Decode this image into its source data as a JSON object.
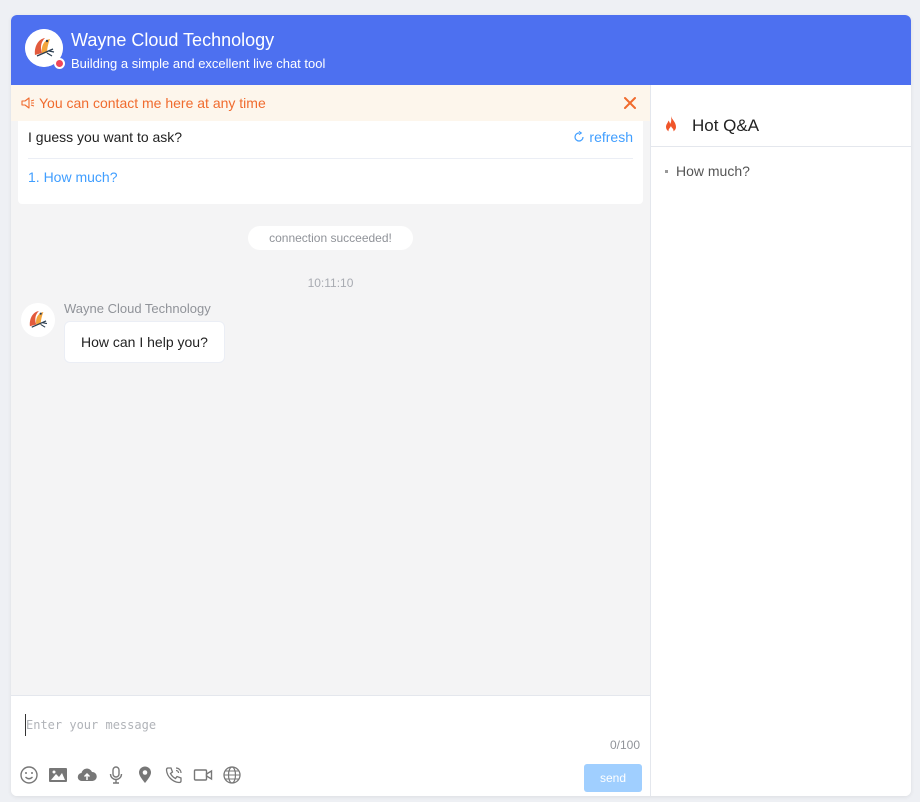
{
  "header": {
    "title": "Wayne Cloud Technology",
    "subtitle": "Building a simple and excellent live chat tool",
    "status_color": "#f0475a"
  },
  "notice": {
    "text": "You can contact me here at any time",
    "icon": "speaker-icon",
    "color": "#f06b2e"
  },
  "guess": {
    "title": "I guess you want to ask?",
    "refresh_label": "refresh",
    "items": [
      "1. How much?"
    ]
  },
  "chat": {
    "system_message": "connection succeeded!",
    "timestamp": "10:11:10",
    "messages": [
      {
        "sender": "Wayne Cloud Technology",
        "text": "How can I help you?"
      }
    ]
  },
  "input": {
    "placeholder": "Enter your message",
    "value": "",
    "counter": "0/100",
    "send_label": "send",
    "tools": [
      "emoji-icon",
      "image-icon",
      "upload-icon",
      "microphone-icon",
      "location-icon",
      "phone-icon",
      "video-icon",
      "globe-icon"
    ]
  },
  "sidebar": {
    "title": "Hot Q&A",
    "items": [
      "How much?"
    ]
  },
  "colors": {
    "brand": "#4d70f0",
    "link": "#409eff",
    "send_disabled": "#a0cfff"
  }
}
